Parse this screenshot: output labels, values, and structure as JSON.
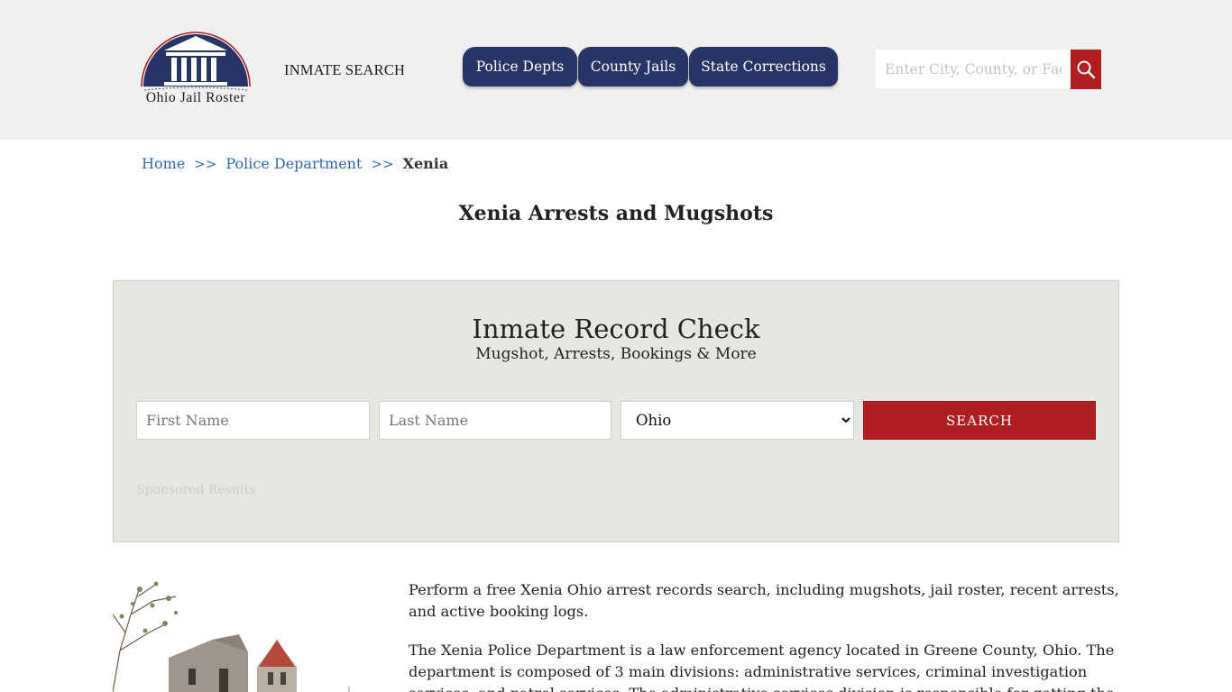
{
  "header": {
    "logo_text": "Ohio Jail Roster",
    "inmate_search_label": "INMATE SEARCH",
    "nav": [
      {
        "label": "Police Depts"
      },
      {
        "label": "County Jails"
      },
      {
        "label": "State Corrections"
      }
    ],
    "search_placeholder": "Enter City, County, or Facility",
    "search_icon": "search-icon"
  },
  "breadcrumb": {
    "home": "Home",
    "separator": ">>",
    "section": "Police Department",
    "current": "Xenia"
  },
  "page_title": "Xenia Arrests and Mugshots",
  "record_check": {
    "title": "Inmate Record Check",
    "subtitle": "Mugshot, Arrests, Bookings & More",
    "first_name_placeholder": "First Name",
    "last_name_placeholder": "Last Name",
    "state_selected": "Ohio",
    "search_label": "SEARCH",
    "sponsored": "Sponsored Results"
  },
  "content": {
    "paragraph_1": "Perform a free Xenia Ohio arrest records search, including mugshots, jail roster, recent arrests, and active booking logs.",
    "paragraph_2": "The Xenia Police Department is a law enforcement agency located in Greene County, Ohio. The department is composed of 3 main divisions: administrative services, criminal investigation services, and patrol services. The administrative services division is responsible for getting the accreditation for"
  },
  "colors": {
    "header_bg": "#f0f0f0",
    "nav_bg": "#283466",
    "accent_red": "#b01e21",
    "link_blue": "#2f6bb5",
    "panel_bg": "#e8e6e1"
  }
}
